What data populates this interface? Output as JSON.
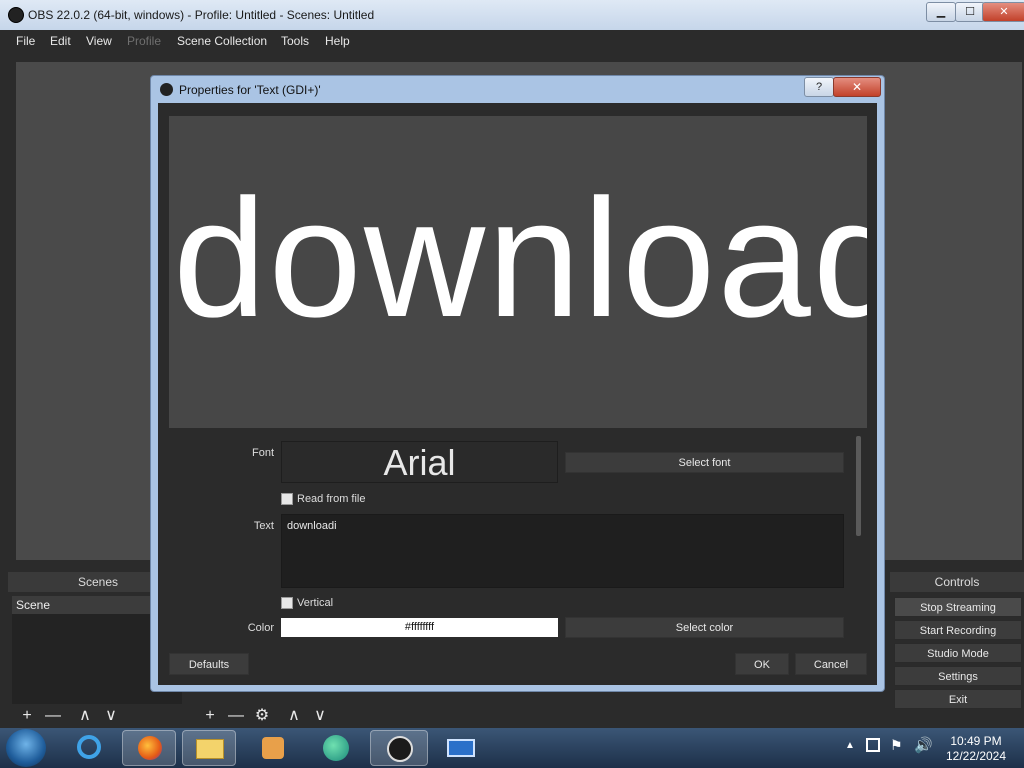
{
  "window": {
    "title": "OBS 22.0.2 (64-bit, windows) - Profile: Untitled - Scenes: Untitled",
    "controls": {
      "minimize": "▁",
      "maximize": "☐",
      "close": "✕"
    }
  },
  "menu": [
    {
      "label": "File"
    },
    {
      "label": "Edit"
    },
    {
      "label": "View"
    },
    {
      "label": "Profile",
      "disabled": true
    },
    {
      "label": "Scene Collection"
    },
    {
      "label": "Tools"
    },
    {
      "label": "Help"
    }
  ],
  "scenes_dock": {
    "title": "Scenes",
    "items": [
      "Scene"
    ],
    "toolbar": {
      "add": "+",
      "remove": "—",
      "up": "∧",
      "down": "∨"
    }
  },
  "sources_toolbar": {
    "add": "+",
    "remove": "—",
    "settings": "⚙",
    "up": "∧",
    "down": "∨"
  },
  "controls_dock": {
    "title": "Controls",
    "buttons": [
      "Stop Streaming",
      "Start Recording",
      "Studio Mode",
      "Settings",
      "Exit"
    ]
  },
  "dialog": {
    "title": "Properties for 'Text (GDI+)'",
    "help": "?",
    "close": "✕",
    "preview_text": "downloadi",
    "font_label": "Font",
    "font_value": "Arial",
    "select_font": "Select font",
    "read_from_file": "Read from file",
    "read_from_file_checked": false,
    "text_label": "Text",
    "text_value": "downloadi",
    "vertical": "Vertical",
    "vertical_checked": false,
    "color_label": "Color",
    "color_value": "#ffffffff",
    "select_color": "Select color",
    "defaults": "Defaults",
    "ok": "OK",
    "cancel": "Cancel"
  },
  "taskbar": {
    "apps": [
      "start-orb",
      "internet-explorer",
      "firefox",
      "file-explorer",
      "media-player",
      "edge",
      "obs",
      "remote-desktop"
    ],
    "time": "10:49 PM",
    "date": "12/22/2024",
    "tray": [
      "show-hidden-icons",
      "network-icon",
      "action-center-flag-icon",
      "volume-icon"
    ]
  },
  "colors": {
    "obs_dark": "#2b2b2b",
    "obs_panel": "#3c3c3c",
    "dialog_frame": "#aac4e4",
    "taskbar": "#1d3049"
  }
}
